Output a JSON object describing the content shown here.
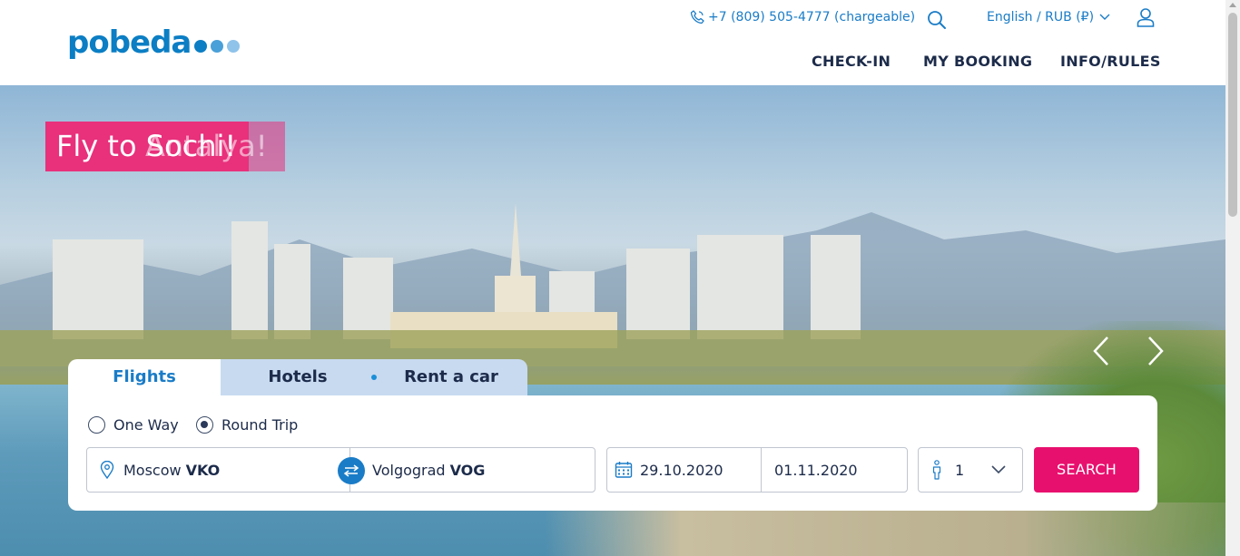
{
  "brand": {
    "logo_text": "pobeda",
    "dot_colors": [
      "#0b7ec4",
      "#4aa0d8",
      "#8fc3ea"
    ]
  },
  "header": {
    "phone": "+7 (809) 505-4777 (chargeable)",
    "language_currency": "English / RUB (₽)",
    "nav": {
      "checkin": "CHECK-IN",
      "booking": "MY BOOKING",
      "info": "INFO/RULES"
    }
  },
  "hero": {
    "promo_text": "Fly to Sochi!",
    "promo_ghost_text": "Antalya!"
  },
  "booking": {
    "tabs": {
      "flights": "Flights",
      "hotels": "Hotels",
      "car": "Rent a car"
    },
    "trip_types": {
      "one_way": "One Way",
      "round_trip": "Round Trip",
      "selected": "Round Trip"
    },
    "from_city": "Moscow",
    "from_code": "VKO",
    "to_city": "Volgograd",
    "to_code": "VOG",
    "date_from": "29.10.2020",
    "date_to": "01.11.2020",
    "passengers": "1",
    "search_label": "SEARCH"
  },
  "colors": {
    "accent": "#1a7cc7",
    "brand_pink": "#e8106e",
    "promo_pink": "#e8307b"
  }
}
